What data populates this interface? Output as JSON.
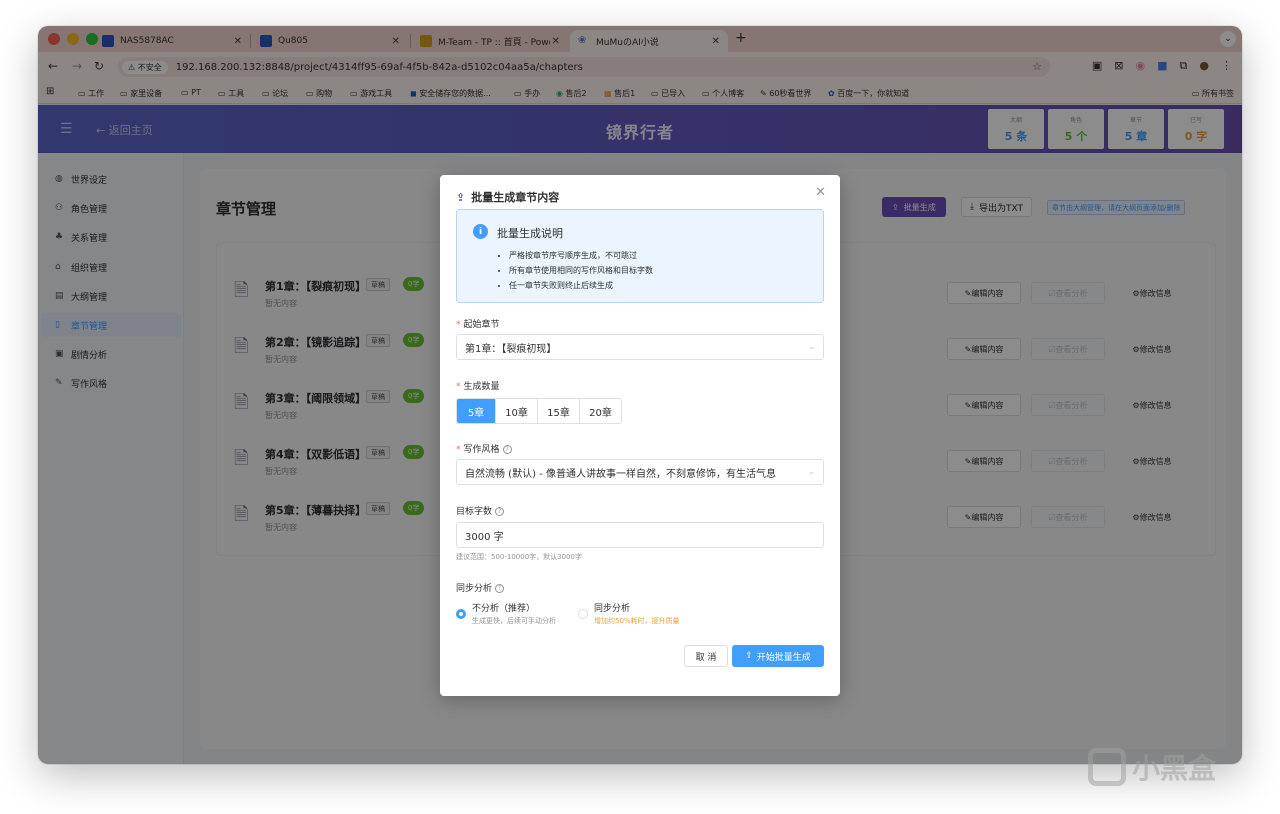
{
  "browser": {
    "tabs": [
      {
        "label": "NAS5878AC"
      },
      {
        "label": "Qu805"
      },
      {
        "label": "M-Team - TP :: 首頁 - Powere"
      },
      {
        "label": "MuMuのAI小说"
      }
    ],
    "insecure_label": "不安全",
    "url": "192.168.200.132:8848/project/4314ff95-69af-4f5b-842a-d5102c04aa5a/chapters",
    "bookmarks": [
      "工作",
      "家里设备",
      "PT",
      "工具",
      "论坛",
      "购物",
      "游戏工具",
      "安全储存您的数据...",
      "手办",
      "售后2",
      "售后1",
      "已导入",
      "个人博客",
      "60秒看世界",
      "百度一下，你就知道"
    ],
    "all_bookmarks": "所有书签"
  },
  "header": {
    "back": "返回主页",
    "title": "镜界行者",
    "stats": [
      {
        "label": "大纲",
        "value": "5 条",
        "color": "#409eff"
      },
      {
        "label": "角色",
        "value": "5 个",
        "color": "#67c23a"
      },
      {
        "label": "章节",
        "value": "5 章",
        "color": "#409eff"
      },
      {
        "label": "已写",
        "value": "0 字",
        "color": "#e6a23c"
      }
    ]
  },
  "sidebar": {
    "items": [
      {
        "label": "世界设定",
        "icon": "globe-icon"
      },
      {
        "label": "角色管理",
        "icon": "user-icon"
      },
      {
        "label": "关系管理",
        "icon": "network-icon"
      },
      {
        "label": "组织管理",
        "icon": "bank-icon"
      },
      {
        "label": "大纲管理",
        "icon": "document-icon"
      },
      {
        "label": "章节管理",
        "icon": "file-icon"
      },
      {
        "label": "剧情分析",
        "icon": "chart-icon"
      },
      {
        "label": "写作风格",
        "icon": "pen-icon"
      }
    ]
  },
  "main": {
    "title": "章节管理",
    "batch_button": "批量生成",
    "export_button": "导出为TXT",
    "tip": "章节由大纲管理，请在大纲页面添加/删除",
    "draft_label": "草稿",
    "words_label": "0字",
    "empty_label": "暂无内容",
    "edit_label": "编辑内容",
    "view_label": "查看分析",
    "modify_label": "修改信息",
    "chapters": [
      {
        "title": "第1章：【裂痕初现】"
      },
      {
        "title": "第2章：【镜影追踪】"
      },
      {
        "title": "第3章：【阈限领域】"
      },
      {
        "title": "第4章：【双影低语】"
      },
      {
        "title": "第5章：【薄暮抉择】"
      }
    ]
  },
  "modal": {
    "title": "批量生成章节内容",
    "info_title": "批量生成说明",
    "info_items": [
      "严格按章节序号顺序生成，不可跳过",
      "所有章节使用相同的写作风格和目标字数",
      "任一章节失败则终止后续生成"
    ],
    "start_label": "起始章节",
    "start_value": "第1章：【裂痕初现】",
    "count_label": "生成数量",
    "count_options": [
      "5章",
      "10章",
      "15章",
      "20章"
    ],
    "style_label": "写作风格",
    "style_value": "自然流畅 (默认) - 像普通人讲故事一样自然，不刻意修饰，有生活气息",
    "words_label": "目标字数",
    "words_value": "3000 字",
    "words_hint": "建议范围：500-10000字，默认3000字",
    "sync_label": "同步分析",
    "opt_no": "不分析（推荐）",
    "opt_no_sub": "生成更快，后续可手动分析",
    "opt_yes": "同步分析",
    "opt_yes_sub": "增加约50%耗时，提升质量",
    "cancel": "取 消",
    "start_button": "开始批量生成"
  },
  "watermark": "小黑盒"
}
